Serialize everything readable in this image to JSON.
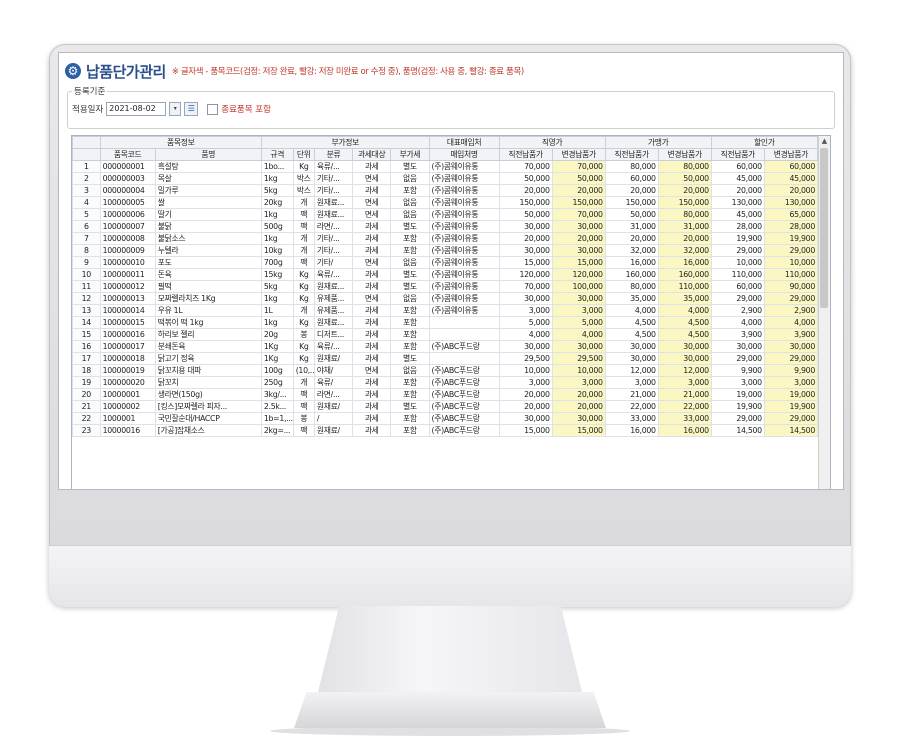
{
  "app": {
    "title": "납품단가관리",
    "note": "※ 글자색 - 품목코드(검정: 저장 완료, 빨강: 저장 미완료 or 수정 중), 품명(검정: 사용 중, 빨강: 종료 품목)",
    "icon": "gear-icon"
  },
  "filter": {
    "group_title": "등록기준",
    "date_label": "적용일자",
    "date_value": "2021-08-02",
    "dropdown_glyph": "▾",
    "list_glyph": "☰",
    "include_discontinued_label": "종료품목 포함"
  },
  "grid": {
    "group_headers": [
      "",
      "품목정보",
      "부가정보",
      "대표매입처",
      "직영가",
      "가맹가",
      "할인가"
    ],
    "columns": [
      "",
      "품목코드",
      "품명",
      "규격",
      "단위",
      "분류",
      "과세대상",
      "부가세",
      "매입처명",
      "직전납품가",
      "변경납품가",
      "직전납품가",
      "변경납품가",
      "직전납품가",
      "변경납품가"
    ],
    "rows": [
      [
        "1",
        "000000001",
        "흑설탕",
        "1bo...",
        "Kg",
        "육류/...",
        "과세",
        "별도",
        "(주)콤웨이유통",
        "70,000",
        "70,000",
        "80,000",
        "80,000",
        "60,000",
        "60,000"
      ],
      [
        "2",
        "000000003",
        "목살",
        "1kg",
        "박스",
        "기타/...",
        "면세",
        "없음",
        "(주)콤웨이유통",
        "50,000",
        "50,000",
        "60,000",
        "50,000",
        "45,000",
        "45,000"
      ],
      [
        "3",
        "000000004",
        "밀가루",
        "5kg",
        "박스",
        "기타/...",
        "과세",
        "포함",
        "(주)콤웨이유통",
        "20,000",
        "20,000",
        "20,000",
        "20,000",
        "20,000",
        "20,000"
      ],
      [
        "4",
        "100000005",
        "쌀",
        "20kg",
        "개",
        "원재료...",
        "면세",
        "없음",
        "(주)콤웨이유통",
        "150,000",
        "150,000",
        "150,000",
        "150,000",
        "130,000",
        "130,000"
      ],
      [
        "5",
        "100000006",
        "딸기",
        "1kg",
        "팩",
        "원재료...",
        "면세",
        "없음",
        "(주)콤웨이유통",
        "50,000",
        "70,000",
        "50,000",
        "80,000",
        "45,000",
        "65,000"
      ],
      [
        "6",
        "100000007",
        "불닭",
        "500g",
        "팩",
        "라면/...",
        "과세",
        "별도",
        "(주)콤웨이유통",
        "30,000",
        "30,000",
        "31,000",
        "31,000",
        "28,000",
        "28,000"
      ],
      [
        "7",
        "100000008",
        "불닭소스",
        "1kg",
        "개",
        "기타/...",
        "과세",
        "포함",
        "(주)콤웨이유통",
        "20,000",
        "20,000",
        "20,000",
        "20,000",
        "19,900",
        "19,900"
      ],
      [
        "8",
        "100000009",
        "누텔라",
        "10kg",
        "개",
        "기타/...",
        "과세",
        "포함",
        "(주)콤웨이유통",
        "30,000",
        "30,000",
        "32,000",
        "32,000",
        "29,000",
        "29,000"
      ],
      [
        "9",
        "100000010",
        "포도",
        "700g",
        "팩",
        "기타/",
        "면세",
        "없음",
        "(주)콤웨이유통",
        "15,000",
        "15,000",
        "16,000",
        "16,000",
        "10,000",
        "10,000"
      ],
      [
        "10",
        "100000011",
        "돈육",
        "15kg",
        "Kg",
        "육류/...",
        "과세",
        "별도",
        "(주)콤웨이유통",
        "120,000",
        "120,000",
        "160,000",
        "160,000",
        "110,000",
        "110,000"
      ],
      [
        "11",
        "100000012",
        "필떡",
        "5kg",
        "Kg",
        "원재료...",
        "과세",
        "별도",
        "(주)콤웨이유통",
        "70,000",
        "100,000",
        "80,000",
        "110,000",
        "60,000",
        "90,000"
      ],
      [
        "12",
        "100000013",
        "모짜렐라치즈 1Kg",
        "1kg",
        "Kg",
        "유제품...",
        "면세",
        "없음",
        "(주)콤웨이유통",
        "30,000",
        "30,000",
        "35,000",
        "35,000",
        "29,000",
        "29,000"
      ],
      [
        "13",
        "100000014",
        "우유 1L",
        "1L",
        "개",
        "유제품...",
        "과세",
        "포함",
        "(주)콤웨이유통",
        "3,000",
        "3,000",
        "4,000",
        "4,000",
        "2,900",
        "2,900"
      ],
      [
        "14",
        "100000015",
        "떡볶이 떡 1kg",
        "1kg",
        "Kg",
        "원재료...",
        "과세",
        "포함",
        "",
        "5,000",
        "5,000",
        "4,500",
        "4,500",
        "4,000",
        "4,000"
      ],
      [
        "15",
        "100000016",
        "하리보 젤리",
        "20g",
        "봉",
        "디저트...",
        "과세",
        "포함",
        "",
        "4,000",
        "4,000",
        "4,500",
        "4,500",
        "3,900",
        "3,900"
      ],
      [
        "16",
        "100000017",
        "분쇄돈육",
        "1Kg",
        "Kg",
        "육류/...",
        "과세",
        "포함",
        "(주)ABC푸드랑",
        "30,000",
        "30,000",
        "30,000",
        "30,000",
        "30,000",
        "30,000"
      ],
      [
        "17",
        "100000018",
        "닭고기 정육",
        "1Kg",
        "Kg",
        "원재료/",
        "과세",
        "별도",
        "",
        "29,500",
        "29,500",
        "30,000",
        "30,000",
        "29,000",
        "29,000"
      ],
      [
        "18",
        "100000019",
        "닭꼬치용 대파",
        "100g",
        "(10,...",
        "야채/",
        "면세",
        "없음",
        "(주)ABC푸드랑",
        "10,000",
        "10,000",
        "12,000",
        "12,000",
        "9,900",
        "9,900"
      ],
      [
        "19",
        "100000020",
        "닭꼬치",
        "250g",
        "개",
        "육류/",
        "과세",
        "포함",
        "(주)ABC푸드랑",
        "3,000",
        "3,000",
        "3,000",
        "3,000",
        "3,000",
        "3,000"
      ],
      [
        "20",
        "10000001",
        "생라면(150g)",
        "3kg/...",
        "팩",
        "라면/...",
        "과세",
        "포함",
        "(주)ABC푸드랑",
        "20,000",
        "20,000",
        "21,000",
        "21,000",
        "19,000",
        "19,000"
      ],
      [
        "21",
        "10000002",
        "[킹스]모짜렐라 피자...",
        "2.5k...",
        "팩",
        "원재료/",
        "과세",
        "별도",
        "(주)ABC푸드랑",
        "20,000",
        "20,000",
        "22,000",
        "22,000",
        "19,900",
        "19,900"
      ],
      [
        "22",
        "1000001",
        "국민잘순대/HACCP",
        "1b=1,...",
        "봉",
        "/",
        "과세",
        "포함",
        "(주)ABC푸드랑",
        "30,000",
        "30,000",
        "33,000",
        "33,000",
        "29,000",
        "29,000"
      ],
      [
        "23",
        "10000016",
        "[가공]잡채소스",
        "2kg=...",
        "팩",
        "원재료/",
        "과세",
        "포함",
        "(주)ABC푸드랑",
        "15,000",
        "15,000",
        "16,000",
        "16,000",
        "14,500",
        "14,500"
      ]
    ],
    "scroll_up_glyph": "▲"
  }
}
